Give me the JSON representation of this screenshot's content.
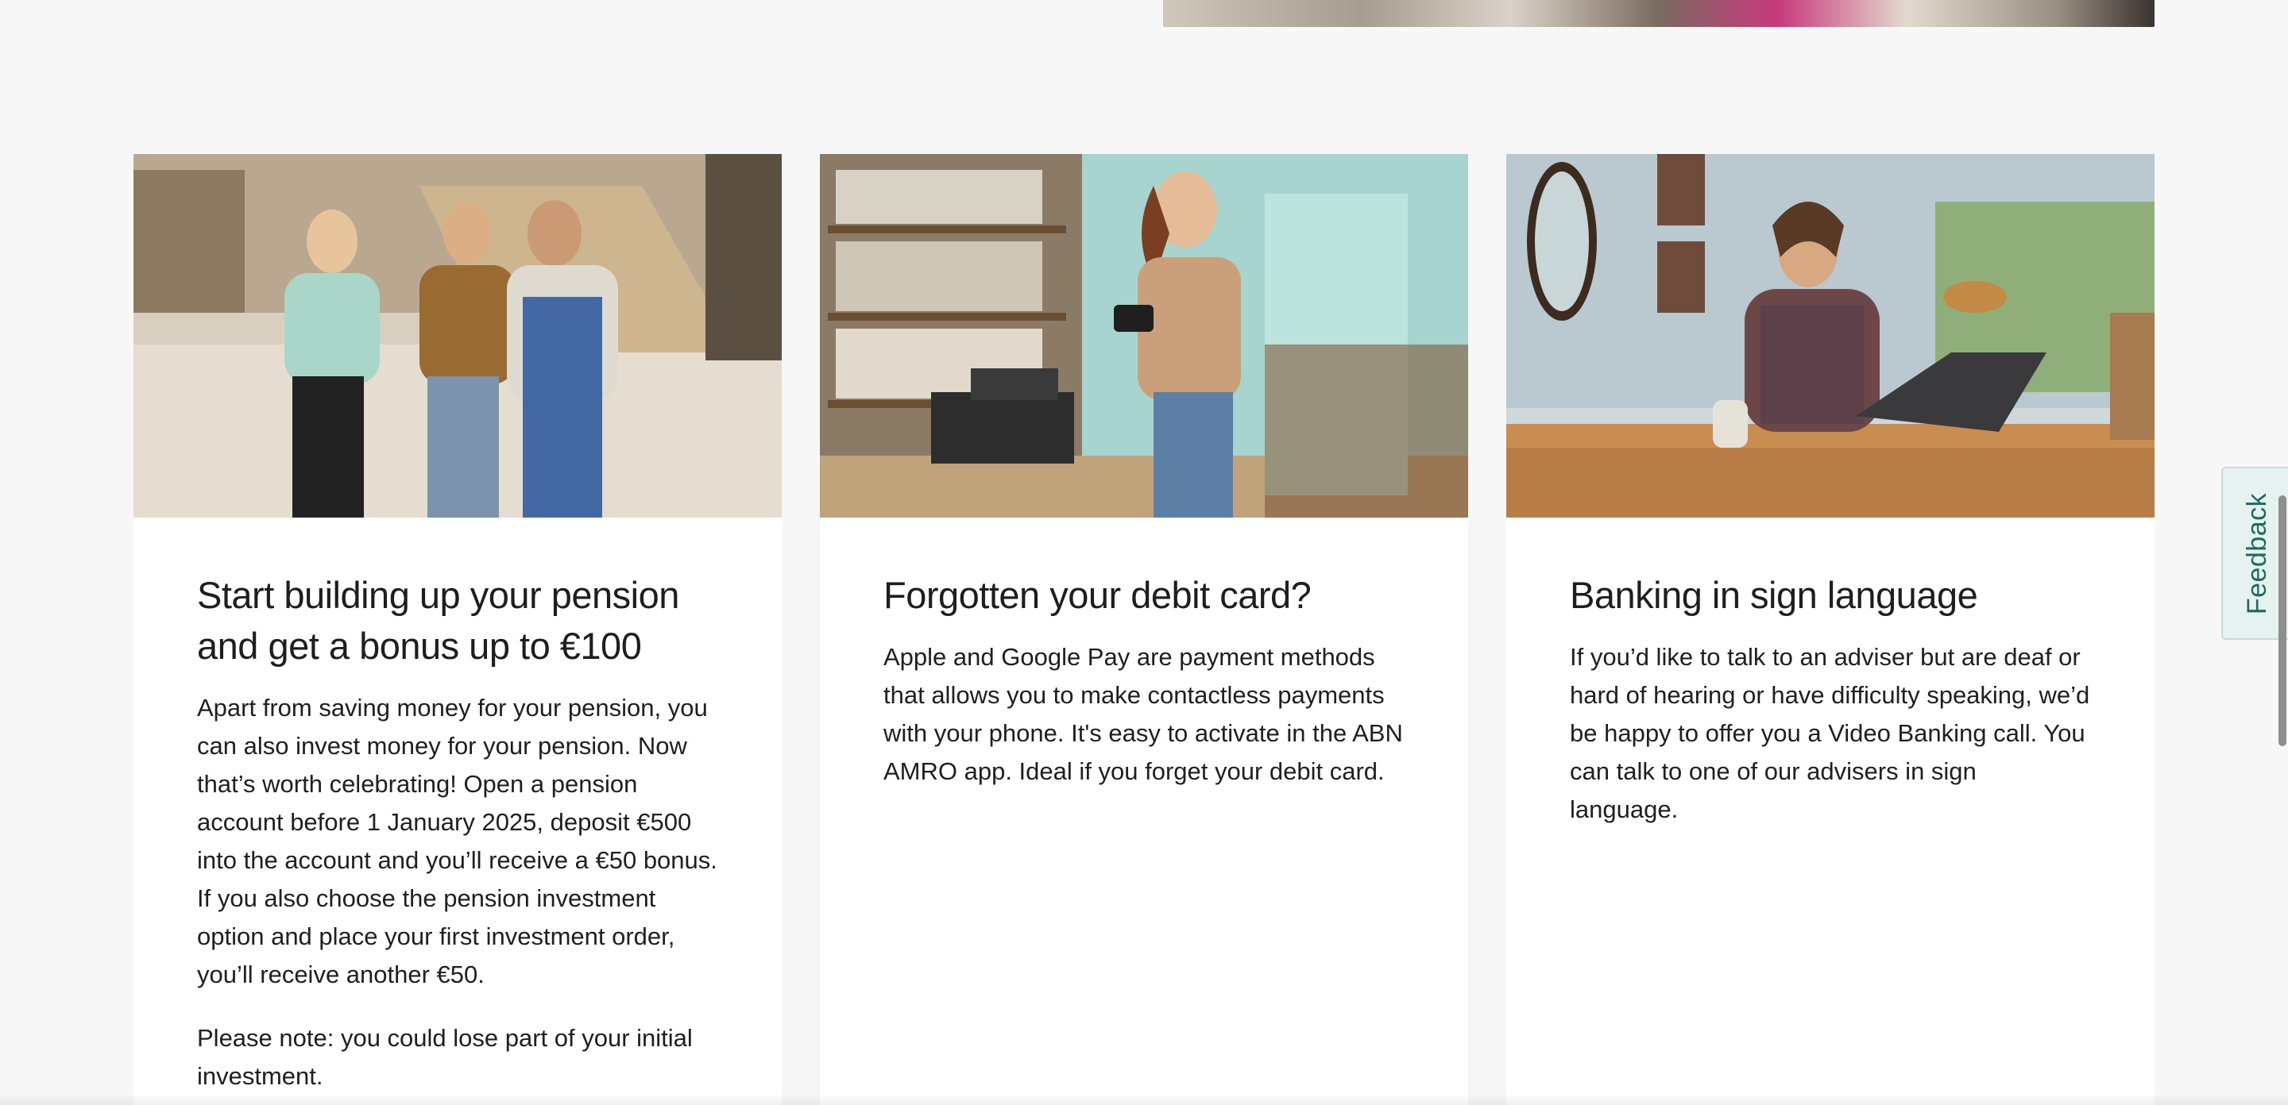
{
  "cards": [
    {
      "image_alt": "Three women smiling in a shopping mall",
      "title": "Start building up your pension and get a bonus up to €100",
      "paragraphs": [
        "Apart from saving money for your pension, you can also invest money for your pension. Now that’s worth celebrating! Open a pension account before 1 January 2025, deposit €500 into the account and you’ll receive a €50 bonus. If you also choose the pension investment option and place your first investment order, you’ll receive another €50.",
        "Please note: you could lose part of your initial investment."
      ]
    },
    {
      "image_alt": "Woman paying with phone at a shop counter",
      "title": "Forgotten your debit card?",
      "paragraphs": [
        "Apple and Google Pay are payment methods that allows you to make contactless payments with your phone. It's easy to activate in the ABN AMRO app. Ideal if you forget your debit card."
      ]
    },
    {
      "image_alt": "Woman signing on a video call at a laptop",
      "title": "Banking in sign language",
      "paragraphs": [
        " If you’d like to talk to an adviser but are deaf or hard of hearing or have difficulty speaking, we’d be happy to offer you a Video Banking call. You can talk to one of our advisers in sign language."
      ]
    }
  ],
  "feedback": {
    "label": "Feedback"
  },
  "colors": {
    "background": "#f7f7f7",
    "card": "#ffffff",
    "feedback_text": "#1c6b5d",
    "feedback_bg": "#e6f2ef"
  }
}
